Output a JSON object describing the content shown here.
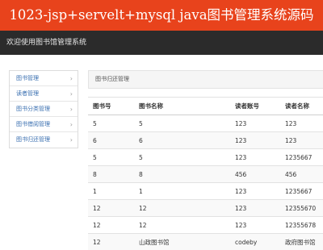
{
  "banner": {
    "title": "1023-jsp+servelt+mysql java图书管理系统源码"
  },
  "app": {
    "title": "欢迎使用图书馆管理系统"
  },
  "sidebar": {
    "items": [
      {
        "label": "图书管理"
      },
      {
        "label": "读者管理"
      },
      {
        "label": "图书分类管理"
      },
      {
        "label": "图书借阅管理"
      },
      {
        "label": "图书归还管理"
      }
    ]
  },
  "breadcrumb": {
    "text": "图书归还管理"
  },
  "table": {
    "headers": [
      "图书号",
      "图书名称",
      "读者账号",
      "读者名称"
    ],
    "rows": [
      [
        "5",
        "5",
        "123",
        "123"
      ],
      [
        "6",
        "6",
        "123",
        "123"
      ],
      [
        "5",
        "5",
        "123",
        "1235667"
      ],
      [
        "8",
        "8",
        "456",
        "456"
      ],
      [
        "1",
        "1",
        "123",
        "1235667"
      ],
      [
        "12",
        "12",
        "123",
        "12355670"
      ],
      [
        "12",
        "12",
        "123",
        "12355678"
      ],
      [
        "12",
        "山政图书馆",
        "codeby",
        "政府图书馆"
      ]
    ]
  },
  "colors": {
    "banner_bg": "#e8431c",
    "appbar_bg": "#2b2b2b",
    "link": "#3a6fb0"
  }
}
